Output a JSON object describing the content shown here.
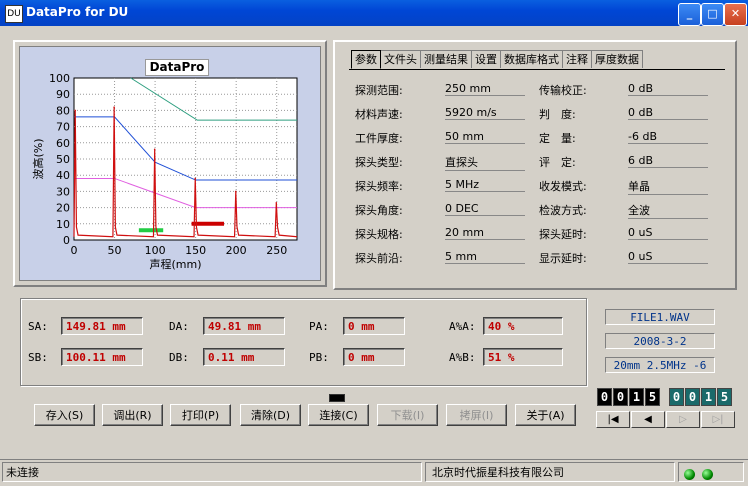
{
  "window": {
    "title": "DataPro for DU",
    "icon_text": "DU"
  },
  "chart": {
    "title": "DataPro",
    "xlabel": "声程(mm)",
    "ylabel": "波高(%)",
    "xticks": [
      "0",
      "50",
      "100",
      "150",
      "200",
      "250"
    ],
    "yticks": [
      "0",
      "10",
      "20",
      "30",
      "40",
      "50",
      "60",
      "70",
      "80",
      "90",
      "100"
    ]
  },
  "chart_data": {
    "type": "line",
    "title": "DataPro",
    "xlabel": "声程(mm)",
    "ylabel": "波高(%)",
    "xlim": [
      0,
      275
    ],
    "ylim": [
      0,
      100
    ],
    "grid": true,
    "echo_peaks": [
      {
        "x": 2,
        "y": 80
      },
      {
        "x": 50,
        "y": 82
      },
      {
        "x": 100,
        "y": 56
      },
      {
        "x": 150,
        "y": 38
      },
      {
        "x": 200,
        "y": 30
      },
      {
        "x": 250,
        "y": 23
      }
    ],
    "series": [
      {
        "color": "#2d9e7f",
        "x": [
          70,
          152,
          275
        ],
        "y": [
          100,
          74,
          74
        ]
      },
      {
        "color": "#1f4fd6",
        "x": [
          0,
          50,
          100,
          150,
          275
        ],
        "y": [
          76,
          76,
          48,
          37,
          37
        ]
      },
      {
        "color": "#e060e0",
        "x": [
          0,
          50,
          150,
          275
        ],
        "y": [
          38,
          38,
          20,
          20
        ]
      }
    ],
    "gates": [
      {
        "color": "#22cc44",
        "x": [
          80,
          110
        ],
        "y": 6
      },
      {
        "color": "#cc0000",
        "x": [
          145,
          185
        ],
        "y": 10
      }
    ]
  },
  "tabs": [
    {
      "label": "参数",
      "active": true
    },
    {
      "label": "文件头"
    },
    {
      "label": "测量结果"
    },
    {
      "label": "设置"
    },
    {
      "label": "数据库格式"
    },
    {
      "label": "注释"
    },
    {
      "label": "厚度数据"
    }
  ],
  "params_left": [
    {
      "label": "探测范围:",
      "value": "250 mm"
    },
    {
      "label": "材料声速:",
      "value": "5920 m/s"
    },
    {
      "label": "工件厚度:",
      "value": "50 mm"
    },
    {
      "label": "探头类型:",
      "value": "直探头"
    },
    {
      "label": "探头频率:",
      "value": "5 MHz"
    },
    {
      "label": "探头角度:",
      "value": "0 DEC"
    },
    {
      "label": "探头规格:",
      "value": "20 mm"
    },
    {
      "label": "探头前沿:",
      "value": "5 mm"
    }
  ],
  "params_right": [
    {
      "label": "传输校正:",
      "value": "0 dB"
    },
    {
      "label": "判　度:",
      "value": "0 dB"
    },
    {
      "label": "定　量:",
      "value": "-6 dB"
    },
    {
      "label": "评　定:",
      "value": "6 dB"
    },
    {
      "label": "收发模式:",
      "value": "单晶"
    },
    {
      "label": "检波方式:",
      "value": "全波"
    },
    {
      "label": "探头延时:",
      "value": "0 uS"
    },
    {
      "label": "显示延时:",
      "value": "0 uS"
    }
  ],
  "measurements": {
    "sa": {
      "label": "SA:",
      "value": "149.81 mm"
    },
    "sb": {
      "label": "SB:",
      "value": "100.11 mm"
    },
    "da": {
      "label": "DA:",
      "value": "49.81 mm"
    },
    "db": {
      "label": "DB:",
      "value": "0.11 mm"
    },
    "pa": {
      "label": "PA:",
      "value": "0 mm"
    },
    "pb": {
      "label": "PB:",
      "value": "0 mm"
    },
    "apct": {
      "label": "A%A:",
      "value": "40 %"
    },
    "bpct": {
      "label": "A%B:",
      "value": "51 %"
    }
  },
  "file_info": {
    "filename": "FILE1.WAV",
    "date": "2008-3-2",
    "probe": "20mm 2.5MHz -6"
  },
  "buttons": [
    {
      "label": "存入(S)",
      "enabled": true
    },
    {
      "label": "调出(R)",
      "enabled": true
    },
    {
      "label": "打印(P)",
      "enabled": true
    },
    {
      "label": "清除(D)",
      "enabled": true
    },
    {
      "label": "连接(C)",
      "enabled": true
    },
    {
      "label": "下载(I)",
      "enabled": false
    },
    {
      "label": "拷屏(I)",
      "enabled": false
    },
    {
      "label": "关于(A)",
      "enabled": true
    }
  ],
  "counters": {
    "current": "0015",
    "total": "0015"
  },
  "nav": [
    "|◀",
    "◀",
    "▷",
    "▷|"
  ],
  "status": {
    "connection": "未连接",
    "company": "北京时代振星科技有限公司"
  }
}
